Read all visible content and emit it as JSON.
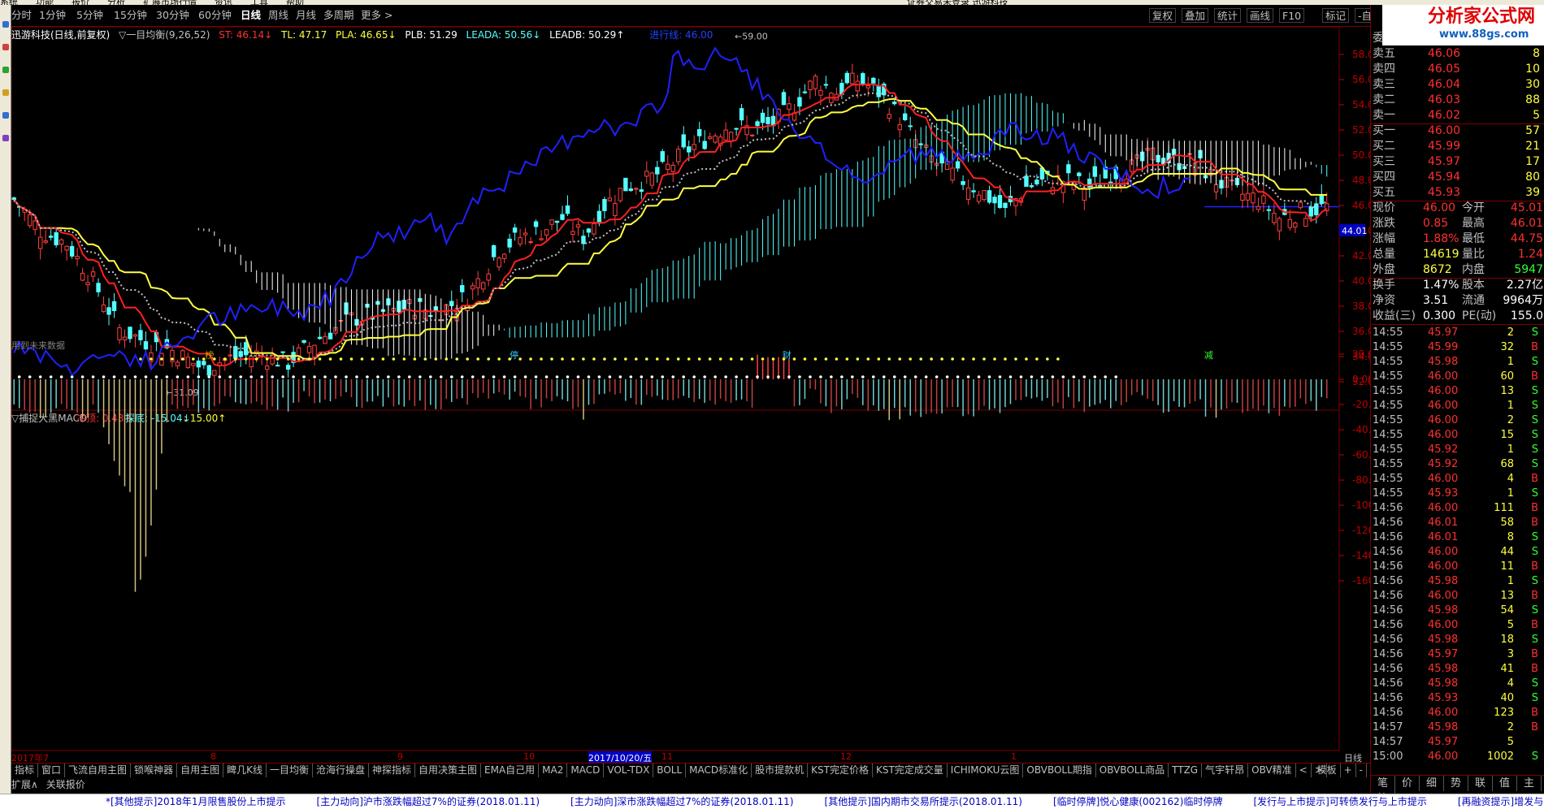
{
  "menubar": {
    "items": [
      "系统",
      "功能",
      "报价",
      "分析",
      "扩展市场行情",
      "资讯",
      "工具",
      "帮助",
      "证券交易未登录  迅游科技"
    ]
  },
  "toolbar": {
    "left": [
      {
        "label": "分时",
        "active": false
      },
      {
        "label": "1分钟",
        "active": false
      },
      {
        "label": "5分钟",
        "active": false
      },
      {
        "label": "15分钟",
        "active": false
      },
      {
        "label": "30分钟",
        "active": false
      },
      {
        "label": "60分钟",
        "active": false
      },
      {
        "label": "日线",
        "active": true
      },
      {
        "label": "周线",
        "active": false
      },
      {
        "label": "月线",
        "active": false
      },
      {
        "label": "多周期",
        "active": false
      },
      {
        "label": "更多 >",
        "active": false
      }
    ],
    "right": [
      "复权",
      "叠加",
      "统计",
      "画线",
      "F10",
      "标记",
      "-自选",
      "返回"
    ]
  },
  "header": {
    "stock": "迅游科技(日线,前复权)",
    "indicator": "▽一目均衡(9,26,52)",
    "st": "ST: 46.14↓",
    "tl": "TL: 47.17",
    "pla": "PLA: 46.65↓",
    "plb": "PLB: 51.29",
    "leada": "LEADA: 50.56↓",
    "leadb": "LEADB: 50.29↑",
    "progress": "进行线: 46.00"
  },
  "main_chart": {
    "price_axis": [
      58,
      56,
      54,
      52,
      50,
      48,
      46,
      44,
      42,
      40,
      38,
      36,
      34,
      32
    ],
    "current_price_tag": "44.01",
    "high_label": "59.00",
    "low_label": "31.09",
    "future_note": "用到未来数据",
    "markers": [
      {
        "text": "榜",
        "color": "#d0a000",
        "x_frac": 0.147
      },
      {
        "text": "停",
        "color": "#33ccff",
        "x_frac": 0.378
      },
      {
        "text": "财",
        "color": "#33ccff",
        "x_frac": 0.585
      },
      {
        "text": "减",
        "color": "#33ff33",
        "x_frac": 0.905
      }
    ],
    "colors": {
      "up": "#ff4040",
      "down": "#54ffff",
      "tenkan": "#ff2020",
      "kijun": "#ffff40",
      "chikou": "#2020ff",
      "cloud_a": "#ffffff",
      "cloud_b": "#54ffff"
    }
  },
  "sub_chart": {
    "title": "▽捕捉大黑MACD",
    "chongding": "冲顶: 0.43↑",
    "tandi": "探底: -15.04↓",
    "other": ": 15.00↑",
    "axis": [
      "20.00",
      "0.00",
      "-20.00",
      "-40.00",
      "-60.00",
      "-80.00",
      "-100.0",
      "-120.0",
      "-140.0",
      "-160.0"
    ]
  },
  "date_axis": {
    "labels": [
      "2017年7",
      "8",
      "9",
      "10",
      "2017/10/20/五",
      "11",
      "12",
      "1"
    ],
    "right_label": "日线"
  },
  "tabs": [
    "指标",
    "窗口",
    "飞流自用主图",
    "锁喉神器",
    "自用主图",
    "睥几K线",
    "一目均衡",
    "沧海行操盘",
    "神探指标",
    "自用决策主图",
    "EMA自己用",
    "MA2",
    "MACD",
    "VOL-TDX",
    "BOLL",
    "MACD标准化",
    "股市提款机",
    "KST完定价格",
    "KST完定成交量",
    "ICHIMOKU云图",
    "OBVBOLL期指",
    "OBVBOLL商品",
    "TTZG",
    "气宇轩昂",
    "OBV精准",
    "<",
    ">"
  ],
  "tabs_right": [
    "模板",
    "+",
    "-"
  ],
  "expand_row": [
    "扩展∧",
    "关联报价"
  ],
  "ticker": [
    "*[其他提示]2018年1月限售股份上市提示",
    "[主力动向]沪市涨跌幅超过7%的证券(2018.01.11)",
    "[主力动向]深市涨跌幅超过7%的证券(2018.01.11)",
    "[其他提示]国内期市交易所提示(2018.01.11)",
    "[临时停牌]悦心健康(002162)临时停牌",
    "[发行与上市提示]可转债发行与上市提示",
    "[再融资提示]增发与融资"
  ],
  "logo": {
    "title": "分析家公式网",
    "url": "www.88gs.com"
  },
  "quote": {
    "weibi": "委",
    "asks": [
      {
        "label": "卖五",
        "price": "46.06",
        "vol": "8"
      },
      {
        "label": "卖四",
        "price": "46.05",
        "vol": "10"
      },
      {
        "label": "卖三",
        "price": "46.04",
        "vol": "30"
      },
      {
        "label": "卖二",
        "price": "46.03",
        "vol": "88"
      },
      {
        "label": "卖一",
        "price": "46.02",
        "vol": "5"
      }
    ],
    "bids": [
      {
        "label": "买一",
        "price": "46.00",
        "vol": "57"
      },
      {
        "label": "买二",
        "price": "45.99",
        "vol": "21"
      },
      {
        "label": "买三",
        "price": "45.97",
        "vol": "17"
      },
      {
        "label": "买四",
        "price": "45.94",
        "vol": "80"
      },
      {
        "label": "买五",
        "price": "45.93",
        "vol": "39"
      }
    ],
    "stats": [
      {
        "l1": "现价",
        "v1": "46.00",
        "l2": "今开",
        "v2": "45.01"
      },
      {
        "l1": "涨跌",
        "v1": "0.85",
        "l2": "最高",
        "v2": "46.01"
      },
      {
        "l1": "涨幅",
        "v1": "1.88%",
        "l2": "最低",
        "v2": "44.75"
      },
      {
        "l1": "总量",
        "v1": "14619",
        "l2": "量比",
        "v2": "1.24"
      },
      {
        "l1": "外盘",
        "v1": "8672",
        "l2": "内盘",
        "v2": "5947"
      }
    ],
    "fund": [
      {
        "l1": "换手",
        "v1": "1.47%",
        "l2": "股本",
        "v2": "2.27亿"
      },
      {
        "l1": "净资",
        "v1": "3.51",
        "l2": "流通",
        "v2": "9964万"
      },
      {
        "l1": "收益(三)",
        "v1": "0.300",
        "l2": "PE(动)",
        "v2": "155.0"
      }
    ]
  },
  "trades": [
    {
      "t": "14:55",
      "p": "45.97",
      "v": "2",
      "s": "S"
    },
    {
      "t": "14:55",
      "p": "45.99",
      "v": "32",
      "s": "B"
    },
    {
      "t": "14:55",
      "p": "45.98",
      "v": "1",
      "s": "S"
    },
    {
      "t": "14:55",
      "p": "46.00",
      "v": "60",
      "s": "B"
    },
    {
      "t": "14:55",
      "p": "46.00",
      "v": "13",
      "s": "S"
    },
    {
      "t": "14:55",
      "p": "46.00",
      "v": "1",
      "s": "S"
    },
    {
      "t": "14:55",
      "p": "46.00",
      "v": "2",
      "s": "S"
    },
    {
      "t": "14:55",
      "p": "46.00",
      "v": "15",
      "s": "S"
    },
    {
      "t": "14:55",
      "p": "45.92",
      "v": "1",
      "s": "S"
    },
    {
      "t": "14:55",
      "p": "45.92",
      "v": "68",
      "s": "S"
    },
    {
      "t": "14:55",
      "p": "46.00",
      "v": "4",
      "s": "B"
    },
    {
      "t": "14:55",
      "p": "45.93",
      "v": "1",
      "s": "S"
    },
    {
      "t": "14:56",
      "p": "46.00",
      "v": "111",
      "s": "B"
    },
    {
      "t": "14:56",
      "p": "46.01",
      "v": "58",
      "s": "B"
    },
    {
      "t": "14:56",
      "p": "46.01",
      "v": "8",
      "s": "S"
    },
    {
      "t": "14:56",
      "p": "46.00",
      "v": "44",
      "s": "S"
    },
    {
      "t": "14:56",
      "p": "46.00",
      "v": "11",
      "s": "B"
    },
    {
      "t": "14:56",
      "p": "45.98",
      "v": "1",
      "s": "S"
    },
    {
      "t": "14:56",
      "p": "46.00",
      "v": "13",
      "s": "B"
    },
    {
      "t": "14:56",
      "p": "45.98",
      "v": "54",
      "s": "S"
    },
    {
      "t": "14:56",
      "p": "46.00",
      "v": "5",
      "s": "B"
    },
    {
      "t": "14:56",
      "p": "45.98",
      "v": "18",
      "s": "S"
    },
    {
      "t": "14:56",
      "p": "45.97",
      "v": "3",
      "s": "B"
    },
    {
      "t": "14:56",
      "p": "45.98",
      "v": "41",
      "s": "B"
    },
    {
      "t": "14:56",
      "p": "45.98",
      "v": "4",
      "s": "S"
    },
    {
      "t": "14:56",
      "p": "45.93",
      "v": "40",
      "s": "S"
    },
    {
      "t": "14:56",
      "p": "46.00",
      "v": "123",
      "s": "B"
    },
    {
      "t": "14:57",
      "p": "45.98",
      "v": "2",
      "s": "B"
    },
    {
      "t": "14:57",
      "p": "45.97",
      "v": "5",
      "s": ""
    },
    {
      "t": "15:00",
      "p": "46.00",
      "v": "1002",
      "s": "S"
    }
  ],
  "right_tabs": [
    "笔",
    "价",
    "细",
    "势",
    "联",
    "值",
    "主",
    "筹"
  ]
}
